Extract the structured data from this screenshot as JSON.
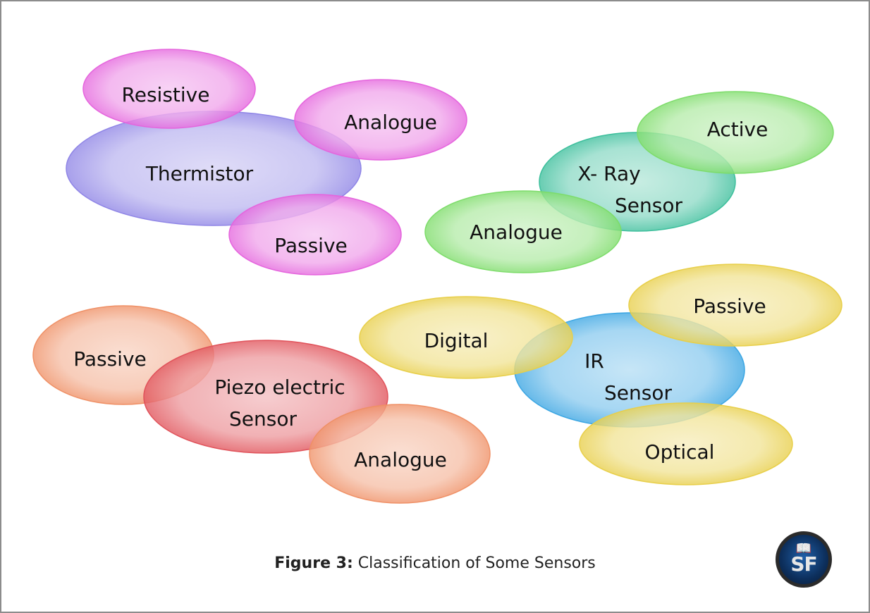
{
  "figure": {
    "caption_label": "Figure 3:",
    "caption_text": "Classification of Some Sensors",
    "logo_text": "SF",
    "logo_icon": "open-book-icon"
  },
  "clusters": [
    {
      "id": "thermistor",
      "center": {
        "lines": [
          "Thermistor"
        ],
        "color": "#8f85e6"
      },
      "attributes": [
        {
          "lines": [
            "Resistive"
          ],
          "color": "#e565dd"
        },
        {
          "lines": [
            "Analogue"
          ],
          "color": "#e565dd"
        },
        {
          "lines": [
            "Passive"
          ],
          "color": "#e565dd"
        }
      ]
    },
    {
      "id": "xray",
      "center": {
        "lines": [
          "X- Ray",
          "Sensor"
        ],
        "color": "#3dbf9c"
      },
      "attributes": [
        {
          "lines": [
            "Active"
          ],
          "color": "#7ddc6a"
        },
        {
          "lines": [
            "Analogue"
          ],
          "color": "#7ddc6a"
        }
      ]
    },
    {
      "id": "piezo",
      "center": {
        "lines": [
          "Piezo electric",
          "Sensor"
        ],
        "color": "#e0525a"
      },
      "attributes": [
        {
          "lines": [
            "Passive"
          ],
          "color": "#ef9066"
        },
        {
          "lines": [
            "Analogue"
          ],
          "color": "#ef9066"
        }
      ]
    },
    {
      "id": "ir",
      "center": {
        "lines": [
          "IR",
          "Sensor"
        ],
        "color": "#3ba6e3"
      },
      "attributes": [
        {
          "lines": [
            "Digital"
          ],
          "color": "#e8cf4a"
        },
        {
          "lines": [
            "Passive"
          ],
          "color": "#e8cf4a"
        },
        {
          "lines": [
            "Optical"
          ],
          "color": "#e8cf4a"
        }
      ]
    }
  ]
}
